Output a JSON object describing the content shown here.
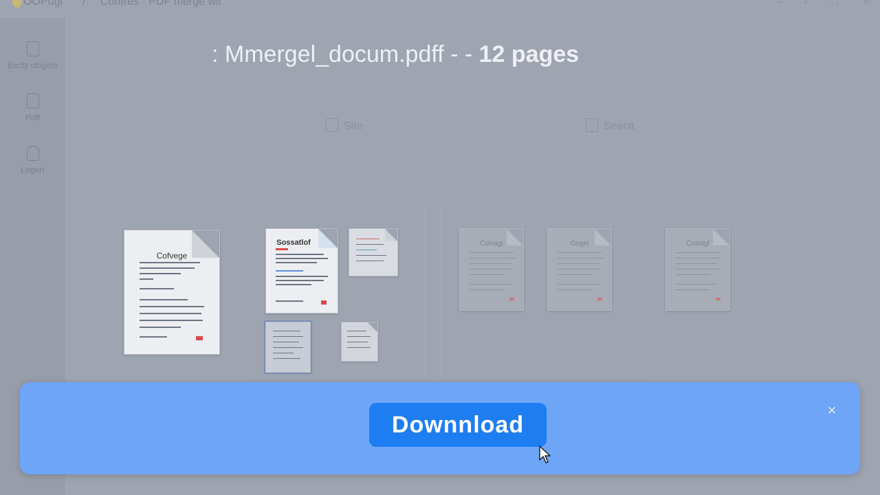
{
  "titlebar": {
    "app_name": "OOPugi",
    "separator": "/",
    "document": "Confres · PDF merge wit"
  },
  "sidebar": {
    "items": [
      {
        "label": "Eecty ofogets",
        "icon": "file-icon"
      },
      {
        "label": "Pdff",
        "icon": "pdf-file-icon"
      },
      {
        "label": "Legert",
        "icon": "lock-icon"
      }
    ]
  },
  "main": {
    "title_name": ": Mmergel_docum.pdff - -",
    "title_count": "12 pages",
    "tools": [
      {
        "label": "Site",
        "icon": "page-icon"
      },
      {
        "label": "Seacit",
        "icon": "bookmark-icon"
      }
    ],
    "pages": [
      {
        "title": "Cofvege"
      },
      {
        "title": "Sossatlof"
      },
      {
        "title": ""
      },
      {
        "title": ""
      },
      {
        "title": ""
      },
      {
        "title": "Colvagi"
      },
      {
        "title": "Gogei"
      },
      {
        "title": "Cosstgl"
      }
    ]
  },
  "download_bar": {
    "button_label": "Downnload",
    "close_label": "×"
  },
  "colors": {
    "accent": "#1f7df2",
    "bar": "#6ea5f7",
    "overlay": "#9ea4b0"
  }
}
